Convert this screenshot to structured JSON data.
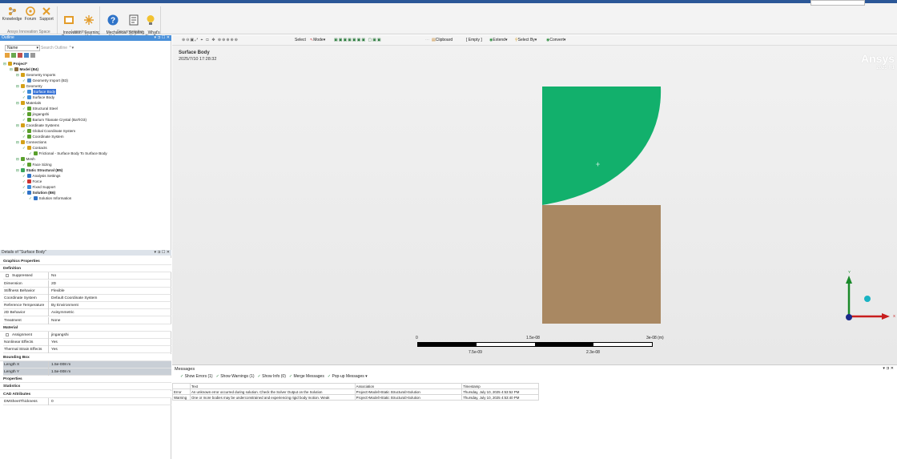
{
  "ribbon": {
    "buttons": [
      {
        "label": "Knowledge",
        "icon": "knowledge-icon"
      },
      {
        "label": "Forum",
        "icon": "forum-icon"
      },
      {
        "label": "Support",
        "icon": "support-icon"
      },
      {
        "label": "Innovation\nCourses",
        "icon": "courses-icon"
      },
      {
        "label": "Learning\nHub",
        "icon": "learning-hub-icon"
      },
      {
        "label": "Mechanical\nHelp",
        "icon": "help-icon"
      },
      {
        "label": "Scripting\nHelp",
        "icon": "scripting-help-icon"
      },
      {
        "label": "What's\nNew?",
        "icon": "lightbulb-icon"
      }
    ],
    "groups": [
      "Ansys Innovation Space",
      "Learning",
      "Documentation"
    ]
  },
  "outline": {
    "title": "Outline",
    "name_filter": "Name",
    "search_placeholder": "Search Outline",
    "tree": [
      {
        "label": "Project*",
        "depth": 0,
        "bold": true
      },
      {
        "label": "Model (B4)",
        "depth": 1,
        "bold": true
      },
      {
        "label": "Geometry Imports",
        "depth": 2
      },
      {
        "label": "Geometry Import (B3)",
        "depth": 3
      },
      {
        "label": "Geometry",
        "depth": 2
      },
      {
        "label": "Surface Body",
        "depth": 3,
        "selected": true
      },
      {
        "label": "Surface Body",
        "depth": 3
      },
      {
        "label": "Materials",
        "depth": 2
      },
      {
        "label": "Structural Steel",
        "depth": 3
      },
      {
        "label": "jingangshi",
        "depth": 3
      },
      {
        "label": "Barium Titanate Crystal (BaTiO3)",
        "depth": 3
      },
      {
        "label": "Coordinate Systems",
        "depth": 2
      },
      {
        "label": "Global Coordinate System",
        "depth": 3
      },
      {
        "label": "Coordinate System",
        "depth": 3
      },
      {
        "label": "Connections",
        "depth": 2
      },
      {
        "label": "Contacts",
        "depth": 3
      },
      {
        "label": "Frictional - Surface Body To Surface Body",
        "depth": 4
      },
      {
        "label": "Mesh",
        "depth": 2
      },
      {
        "label": "Face Sizing",
        "depth": 3
      },
      {
        "label": "Static Structural (B5)",
        "depth": 2,
        "bold": true
      },
      {
        "label": "Analysis Settings",
        "depth": 3
      },
      {
        "label": "Force",
        "depth": 3
      },
      {
        "label": "Fixed Support",
        "depth": 3
      },
      {
        "label": "Solution (B6)",
        "depth": 3,
        "bold": true
      },
      {
        "label": "Solution Information",
        "depth": 4
      }
    ]
  },
  "details": {
    "title": "Details of \"Surface Body\"",
    "rows": [
      {
        "type": "hdr",
        "k": "Graphics Properties"
      },
      {
        "type": "hdr",
        "k": "Definition"
      },
      {
        "k": "Suppressed",
        "v": "No",
        "check": true
      },
      {
        "k": "Dimension",
        "v": "2D"
      },
      {
        "k": "Stiffness Behavior",
        "v": "Flexible"
      },
      {
        "k": "Coordinate System",
        "v": "Default Coordinate System"
      },
      {
        "k": "Reference Temperature",
        "v": "By Environment"
      },
      {
        "k": "2D Behavior",
        "v": "Axisymmetric"
      },
      {
        "k": "Treatment",
        "v": "None"
      },
      {
        "type": "hdr",
        "k": "Material"
      },
      {
        "k": "Assignment",
        "v": "jingangshi",
        "check": true
      },
      {
        "k": "Nonlinear Effects",
        "v": "Yes"
      },
      {
        "k": "Thermal Strain Effects",
        "v": "Yes"
      },
      {
        "type": "hdr",
        "k": "Bounding Box"
      },
      {
        "k": "Length X",
        "v": "1.5e-008 m",
        "gray": true
      },
      {
        "k": "Length Y",
        "v": "1.5e-008 m",
        "gray": true
      },
      {
        "type": "hdr",
        "k": "Properties"
      },
      {
        "type": "hdr",
        "k": "Statistics"
      },
      {
        "type": "hdr",
        "k": "CAD Attributes"
      },
      {
        "k": "DMSheetThickness",
        "v": "0"
      }
    ]
  },
  "toolbar": {
    "select": "Select",
    "mode": "Mode",
    "clipboard": "Clipboard",
    "empty": "[ Empty ]",
    "extend": "Extend",
    "select_by": "Select By",
    "convert": "Convert"
  },
  "viewport": {
    "title": "Surface Body",
    "timestamp": "2025/7/10 17:28:32",
    "brand": "Ansys",
    "version": "2025 R1",
    "scale": {
      "top": [
        "0",
        "1.5e-08",
        "3e-08 (m)"
      ],
      "bottom": [
        "7.5e-09",
        "2.3e-08"
      ]
    },
    "triad": {
      "y": "Y",
      "x": "X"
    },
    "colors": {
      "green_body": "#12b06c",
      "brown_body": "#a98862"
    }
  },
  "messages": {
    "title": "Messages",
    "filters": [
      "Show Errors (1)",
      "Show Warnings (1)",
      "Show Info (0)",
      "Merge Messages",
      "Pop-up Messages"
    ],
    "columns": [
      "Text",
      "Association",
      "Timestamp"
    ],
    "rows": [
      {
        "type": "Error",
        "text": "An unknown error occurred during solution. Check the Solver Output on the Solution",
        "assoc": "Project>Model>Static Structural>Solution",
        "time": "Thursday, July 10, 2025 4:53:52 PM"
      },
      {
        "type": "Warning",
        "text": "One or more bodies may be underconstrained and experiencing rigid body motion. Weak",
        "assoc": "Project>Model>Static Structural>Solution",
        "time": "Thursday, July 10, 2025 4:53:40 PM"
      }
    ]
  }
}
